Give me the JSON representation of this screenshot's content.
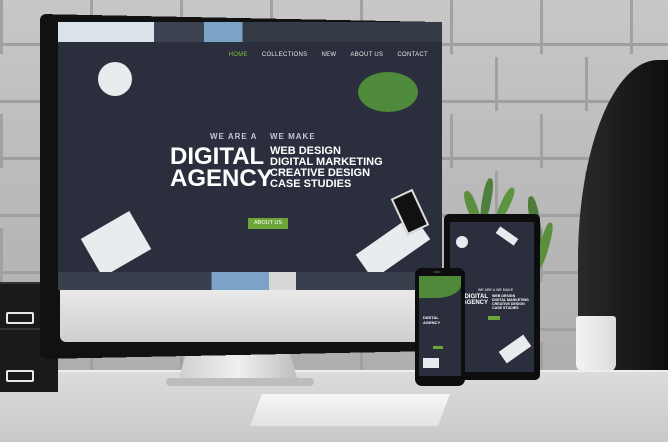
{
  "scene": {
    "wall_color": "#b9b9b9",
    "desk_color": "#dcdcdc",
    "accent": "#6ea53a"
  },
  "website": {
    "nav": [
      {
        "label": "HOME",
        "active": true
      },
      {
        "label": "COLLECTIONS",
        "active": false
      },
      {
        "label": "NEW",
        "active": false
      },
      {
        "label": "ABOUT US",
        "active": false
      },
      {
        "label": "CONTACT",
        "active": false
      }
    ],
    "pre_left": "WE ARE A",
    "pre_right": "WE MAKE",
    "title_line1": "DIGITAL",
    "title_line2": "AGENCY",
    "services": [
      "WEB DESIGN",
      "DIGITAL MARKETING",
      "CREATIVE DESIGN",
      "CASE STUDIES"
    ],
    "cta": "ABOUT US",
    "slides": 5
  }
}
